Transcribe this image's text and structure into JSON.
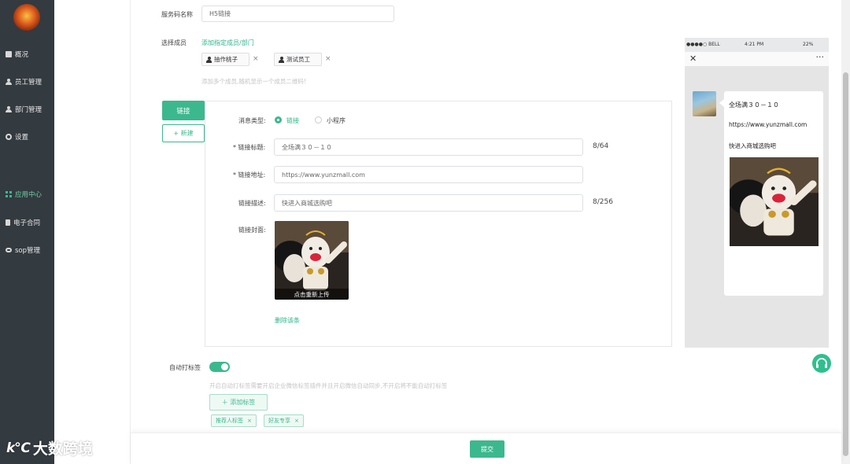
{
  "sidebar": {
    "items": [
      {
        "label": "概况",
        "icon": "overview-icon"
      },
      {
        "label": "员工管理",
        "icon": "staff-icon"
      },
      {
        "label": "部门管理",
        "icon": "department-icon"
      },
      {
        "label": "设置",
        "icon": "settings-icon"
      },
      {
        "label": "应用中心",
        "icon": "app-center-icon"
      },
      {
        "label": "电子合同",
        "icon": "contract-icon"
      },
      {
        "label": "sop管理",
        "icon": "sop-icon"
      }
    ]
  },
  "form": {
    "service_name_label": "服务码名称",
    "service_name_value": "H5链接",
    "members_label": "选择成员",
    "add_members_link": "添加指定成员/部门",
    "members": [
      "抽作桃子",
      "测试员工"
    ],
    "members_hint": "添加多个成员,随机显示一个成员二维码!"
  },
  "tabs": {
    "active": "链接",
    "new": "+ 新建"
  },
  "message": {
    "type_label": "消息类型:",
    "type_link": "链接",
    "type_mini": "小程序",
    "title_label": "* 链接标题:",
    "title_value": "全场满３０－１０",
    "title_count": "8/64",
    "url_label": "* 链接地址:",
    "url_value": "https://www.yunzmall.com",
    "desc_label": "链接描述:",
    "desc_value": "快进入商城选购吧",
    "desc_count": "8/256",
    "cover_label": "链接封面:",
    "cover_upload": "点击重新上传",
    "delete_link": "删除该条"
  },
  "auto_tag": {
    "label": "自动打标签",
    "hint": "开启自动打标签需要开启企业微信标签插件并且开启微信自动同步,不开启将不能自动打标签",
    "add_button": "＋ 添加标签",
    "tags": [
      "推荐人标签",
      "好友专享"
    ]
  },
  "phone": {
    "carrier": "●●●●○ BELL",
    "time": "4:21 PM",
    "battery": "22%",
    "msg_title": "全场满３０－１０",
    "msg_url": "https://www.yunzmall.com",
    "msg_desc": "快进入商城选购吧"
  },
  "footer": {
    "submit": "提交"
  },
  "watermark": {
    "logo": "k℃",
    "text": "大数跨境"
  },
  "colors": {
    "accent": "#3cb88e",
    "sidebar_bg": "#333a40"
  }
}
